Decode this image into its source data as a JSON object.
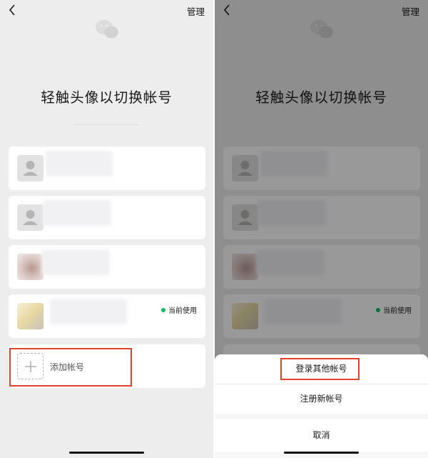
{
  "header": {
    "manage_label": "管理"
  },
  "title": "轻触头像以切换帐号",
  "accounts": [
    {
      "name": "",
      "avatar": "person-placeholder"
    },
    {
      "name": "",
      "avatar": "person-placeholder"
    },
    {
      "name": "",
      "avatar": "photo"
    },
    {
      "name": "",
      "avatar": "photo",
      "status": "当前使用"
    }
  ],
  "add_account_label": "添加帐号",
  "sheet": {
    "login_other_label": "登录其他帐号",
    "register_label": "注册新帐号",
    "cancel_label": "取消"
  },
  "colors": {
    "status_dot": "#07c160",
    "highlight": "#e0422a"
  }
}
